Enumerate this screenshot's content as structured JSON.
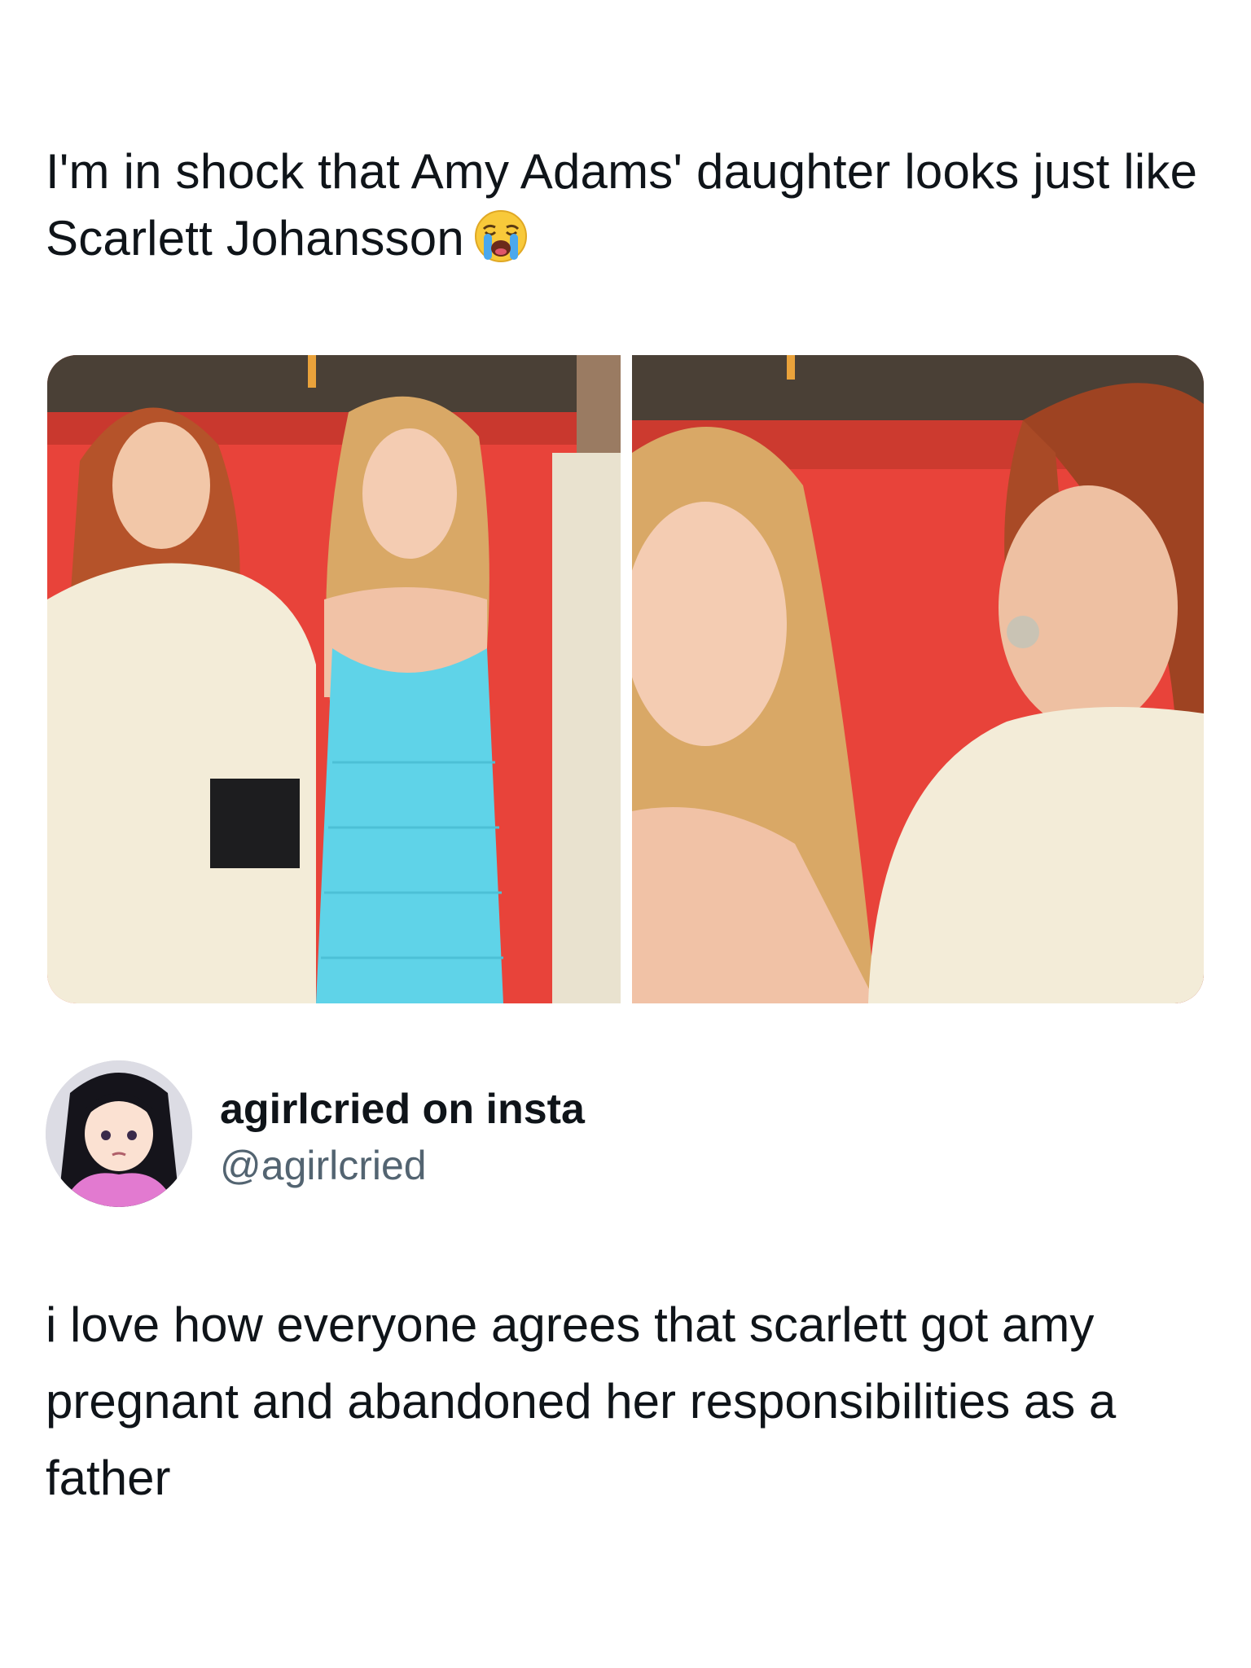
{
  "post": {
    "text": "I'm in shock that Amy Adams' daughter looks just like Scarlett Johansson",
    "emoji": "loudly-crying-face"
  },
  "media": {
    "photos": [
      {
        "name": "red-carpet-full-photo"
      },
      {
        "name": "red-carpet-closeup-photo"
      }
    ]
  },
  "author": {
    "display_name": "agirlcried on insta",
    "handle": "@agirlcried",
    "avatar_icon": "anime-girl-avatar"
  },
  "reply": {
    "text": "i love how everyone agrees that scarlett got amy pregnant and abandoned her responsibilities as a father"
  },
  "colors": {
    "text_primary": "#0f1419",
    "text_secondary": "#536471",
    "backdrop_red": "#e8433a",
    "dress_blue": "#5fd3e8",
    "cream": "#f3ecd8"
  }
}
